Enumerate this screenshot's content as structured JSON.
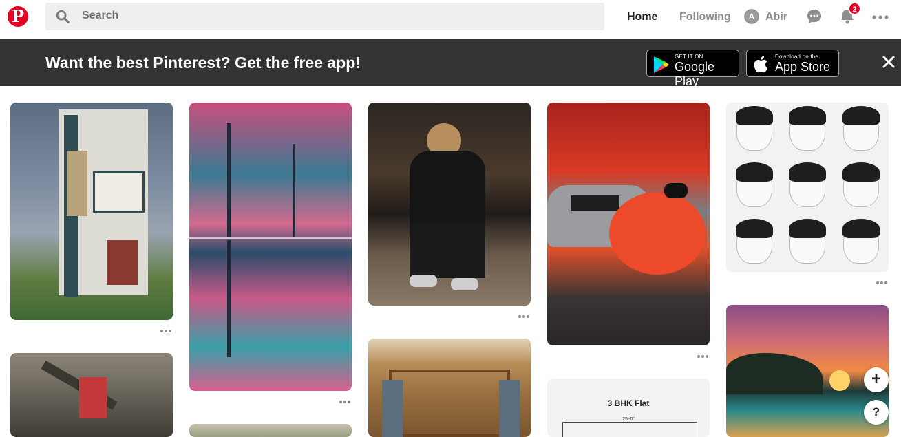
{
  "header": {
    "logo_letter": "P",
    "search_placeholder": "Search",
    "nav": {
      "home": "Home",
      "following": "Following",
      "user_initial": "A",
      "user_name": "Abir"
    },
    "notification_count": "2"
  },
  "banner": {
    "text": "Want the best Pinterest? Get the free app!",
    "google_play": {
      "small": "GET IT ON",
      "big": "Google Play"
    },
    "app_store": {
      "small": "Download on the",
      "big": "App Store"
    }
  },
  "pins": {
    "flat_title": "3 BHK Flat",
    "flat_dimension": "25'-0\""
  },
  "fab": {
    "add": "+",
    "help": "?"
  },
  "colors": {
    "brand": "#e60023",
    "banner_bg": "#333333",
    "search_bg": "#efefef"
  },
  "icons": [
    "search-icon",
    "chat-icon",
    "bell-icon",
    "more-icon",
    "close-icon",
    "google-play-icon",
    "apple-icon"
  ]
}
